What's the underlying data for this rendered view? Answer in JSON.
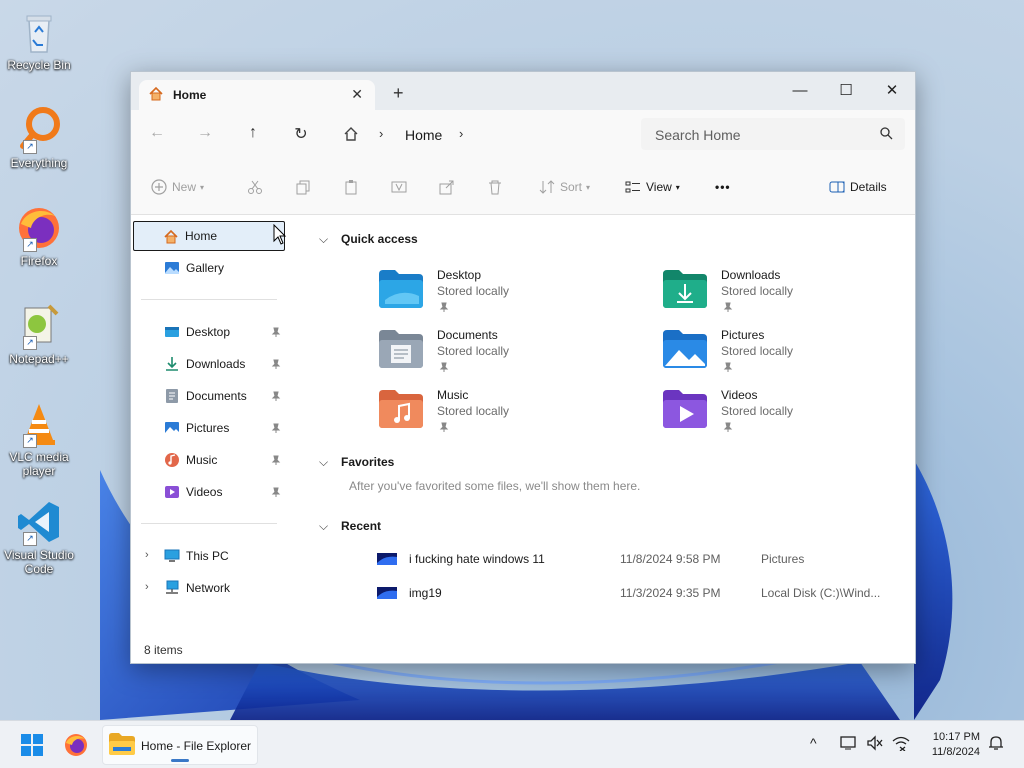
{
  "desktop": {
    "icons": [
      {
        "label": "Recycle Bin",
        "icon": "recycle-bin-icon"
      },
      {
        "label": "Everything",
        "icon": "everything-search-icon"
      },
      {
        "label": "Firefox",
        "icon": "firefox-icon"
      },
      {
        "label": "Notepad++",
        "icon": "notepadpp-icon"
      },
      {
        "label": "VLC media player",
        "icon": "vlc-icon"
      },
      {
        "label": "Visual Studio Code",
        "icon": "vscode-icon"
      }
    ]
  },
  "window": {
    "tab": {
      "label": "Home",
      "close": "✕"
    },
    "new_tab": "+",
    "controls": {
      "minimize": "—",
      "maximize": "☐",
      "close": "✕"
    },
    "nav": {
      "back": "←",
      "forward": "→",
      "up": "↑",
      "refresh": "↻"
    },
    "address": {
      "crumb": "Home",
      "sep": "›"
    },
    "search": {
      "placeholder": "Search Home"
    },
    "toolbar": {
      "new": "New",
      "sort": "Sort",
      "view": "View",
      "more": "•••",
      "details": "Details"
    },
    "sidebar": {
      "home": "Home",
      "gallery": "Gallery",
      "pinned": [
        {
          "label": "Desktop"
        },
        {
          "label": "Downloads"
        },
        {
          "label": "Documents"
        },
        {
          "label": "Pictures"
        },
        {
          "label": "Music"
        },
        {
          "label": "Videos"
        }
      ],
      "this_pc": "This PC",
      "network": "Network",
      "expander": "›"
    },
    "content": {
      "quick_access": {
        "title": "Quick access",
        "items": [
          {
            "name": "Desktop",
            "sub": "Stored locally"
          },
          {
            "name": "Downloads",
            "sub": "Stored locally"
          },
          {
            "name": "Documents",
            "sub": "Stored locally"
          },
          {
            "name": "Pictures",
            "sub": "Stored locally"
          },
          {
            "name": "Music",
            "sub": "Stored locally"
          },
          {
            "name": "Videos",
            "sub": "Stored locally"
          }
        ]
      },
      "favorites": {
        "title": "Favorites",
        "empty": "After you've favorited some files, we'll show them here."
      },
      "recent": {
        "title": "Recent",
        "rows": [
          {
            "name": "i fucking hate windows 11",
            "date": "11/8/2024 9:58 PM",
            "location": "Pictures"
          },
          {
            "name": "img19",
            "date": "11/3/2024 9:35 PM",
            "location": "Local Disk (C:)\\Wind..."
          }
        ]
      },
      "chevron": "⌵"
    },
    "status": "8 items"
  },
  "taskbar": {
    "explorer_label": "Home - File Explorer",
    "time": "10:17 PM",
    "date": "11/8/2024",
    "tray_chevron": "^"
  },
  "colors": {
    "accent": "#0067c0",
    "selection_bg": "#e3eef9",
    "desktop_bloom": "#1447c8"
  }
}
